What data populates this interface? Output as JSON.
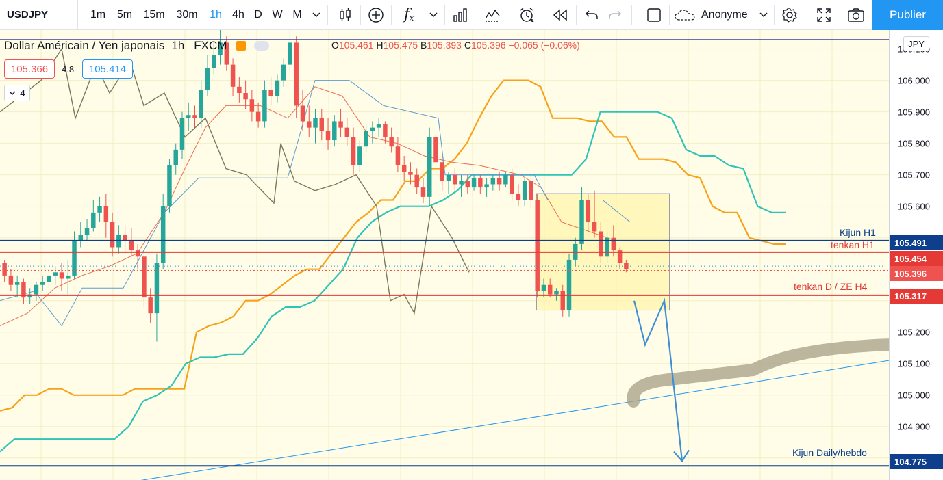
{
  "toolbar": {
    "symbol": "USDJPY",
    "intervals": [
      "1m",
      "5m",
      "15m",
      "30m",
      "1h",
      "4h",
      "D",
      "W",
      "M"
    ],
    "active_interval": "1h",
    "template_label": "Anonyme",
    "publish_label": "Publier",
    "fx_label": "f"
  },
  "legend": {
    "title": "Dollar Américain / Yen japonais",
    "interval": "1h",
    "source": "FXCM",
    "o_label": "O",
    "o": "105.461",
    "h_label": "H",
    "h": "105.475",
    "l_label": "B",
    "l": "105.393",
    "c_label": "C",
    "c": "105.396",
    "change": "−0.065 (−0.06%)",
    "bid": "105.366",
    "spread": "4.8",
    "ask": "105.414",
    "indicators_count": "4"
  },
  "price_axis": {
    "currency": "JPY",
    "ticks": [
      "106.100",
      "106.000",
      "105.900",
      "105.800",
      "105.700",
      "105.600",
      "105.300",
      "105.200",
      "105.100",
      "105.000",
      "104.900",
      "104.800"
    ]
  },
  "levels": [
    {
      "label": "Kijun H1",
      "price": "105.491",
      "color": "#0d3f8c",
      "tag_bg": "#0d3f8c"
    },
    {
      "label": "tenkan H1",
      "price": "105.454",
      "color": "#e53935",
      "tag_bg": "#e53935"
    },
    {
      "label": "",
      "price": "105.396",
      "color": "#ef5350",
      "tag_bg": "#ef5350"
    },
    {
      "label": "tenkan D / ZE H4",
      "price": "105.317",
      "color": "#e53935",
      "tag_bg": "#e53935"
    },
    {
      "label": "Kijun Daily/hebdo",
      "price": "104.775",
      "color": "#0d3f8c",
      "tag_bg": "#0d3f8c"
    }
  ],
  "colors": {
    "up": "#26a69a",
    "down": "#ef5350",
    "accent": "#2196f3",
    "chart_bg": "#fffde7"
  },
  "chart_data": {
    "type": "candlestick",
    "symbol": "USDJPY",
    "interval": "1h",
    "ylim": [
      104.73,
      106.16
    ],
    "candles": [
      [
        105.42,
        105.43,
        105.36,
        105.38
      ],
      [
        105.38,
        105.4,
        105.33,
        105.35
      ],
      [
        105.35,
        105.38,
        105.31,
        105.36
      ],
      [
        105.36,
        105.37,
        105.29,
        105.31
      ],
      [
        105.31,
        105.34,
        105.29,
        105.32
      ],
      [
        105.32,
        105.36,
        105.3,
        105.35
      ],
      [
        105.35,
        105.38,
        105.33,
        105.36
      ],
      [
        105.36,
        105.4,
        105.34,
        105.38
      ],
      [
        105.38,
        105.41,
        105.35,
        105.39
      ],
      [
        105.39,
        105.42,
        105.33,
        105.37
      ],
      [
        105.37,
        105.43,
        105.32,
        105.38
      ],
      [
        105.38,
        105.52,
        105.37,
        105.49
      ],
      [
        105.49,
        105.55,
        105.47,
        105.51
      ],
      [
        105.51,
        105.56,
        105.49,
        105.53
      ],
      [
        105.53,
        105.62,
        105.52,
        105.58
      ],
      [
        105.58,
        105.63,
        105.55,
        105.6
      ],
      [
        105.6,
        105.64,
        105.5,
        105.55
      ],
      [
        105.55,
        105.58,
        105.44,
        105.47
      ],
      [
        105.47,
        105.54,
        105.45,
        105.51
      ],
      [
        105.51,
        105.54,
        105.45,
        105.49
      ],
      [
        105.49,
        105.53,
        105.44,
        105.46
      ],
      [
        105.46,
        105.48,
        105.4,
        105.44
      ],
      [
        105.44,
        105.46,
        105.28,
        105.31
      ],
      [
        105.31,
        105.34,
        105.23,
        105.26
      ],
      [
        105.26,
        105.45,
        105.17,
        105.42
      ],
      [
        105.42,
        105.64,
        105.4,
        105.6
      ],
      [
        105.6,
        105.75,
        105.58,
        105.73
      ],
      [
        105.73,
        105.8,
        105.7,
        105.78
      ],
      [
        105.78,
        105.9,
        105.75,
        105.88
      ],
      [
        105.88,
        105.93,
        105.84,
        105.89
      ],
      [
        105.89,
        105.92,
        105.85,
        105.88
      ],
      [
        105.88,
        106.0,
        105.85,
        105.97
      ],
      [
        105.97,
        106.08,
        105.95,
        106.04
      ],
      [
        106.04,
        106.12,
        106.02,
        106.08
      ],
      [
        106.08,
        106.16,
        106.05,
        106.12
      ],
      [
        106.12,
        106.14,
        106.03,
        106.05
      ],
      [
        106.05,
        106.07,
        105.95,
        105.98
      ],
      [
        105.98,
        106.01,
        105.93,
        105.96
      ],
      [
        105.96,
        106.0,
        105.91,
        105.94
      ],
      [
        105.94,
        105.97,
        105.87,
        105.9
      ],
      [
        105.9,
        105.93,
        105.85,
        105.87
      ],
      [
        105.87,
        106.0,
        105.85,
        105.97
      ],
      [
        105.97,
        106.01,
        105.92,
        105.95
      ],
      [
        105.95,
        106.02,
        105.93,
        106.0
      ],
      [
        106.0,
        106.07,
        105.98,
        106.05
      ],
      [
        106.05,
        106.16,
        106.02,
        106.12
      ],
      [
        106.12,
        106.14,
        105.88,
        105.92
      ],
      [
        105.92,
        105.97,
        105.84,
        105.87
      ],
      [
        105.87,
        105.92,
        105.82,
        105.85
      ],
      [
        105.85,
        105.91,
        105.8,
        105.88
      ],
      [
        105.88,
        105.91,
        105.81,
        105.84
      ],
      [
        105.84,
        105.88,
        105.78,
        105.81
      ],
      [
        105.81,
        105.89,
        105.79,
        105.87
      ],
      [
        105.87,
        105.91,
        105.82,
        105.85
      ],
      [
        105.85,
        105.88,
        105.79,
        105.82
      ],
      [
        105.82,
        105.85,
        105.7,
        105.73
      ],
      [
        105.73,
        105.81,
        105.71,
        105.79
      ],
      [
        105.79,
        105.86,
        105.77,
        105.84
      ],
      [
        105.84,
        105.87,
        105.8,
        105.85
      ],
      [
        105.85,
        105.88,
        105.82,
        105.86
      ],
      [
        105.86,
        105.87,
        105.8,
        105.82
      ],
      [
        105.82,
        105.85,
        105.77,
        105.79
      ],
      [
        105.79,
        105.82,
        105.71,
        105.73
      ],
      [
        105.73,
        105.76,
        105.68,
        105.71
      ],
      [
        105.71,
        105.74,
        105.67,
        105.7
      ],
      [
        105.7,
        105.72,
        105.64,
        105.66
      ],
      [
        105.66,
        105.69,
        105.61,
        105.63
      ],
      [
        105.63,
        105.85,
        105.6,
        105.82
      ],
      [
        105.82,
        105.84,
        105.71,
        105.74
      ],
      [
        105.74,
        105.76,
        105.65,
        105.68
      ],
      [
        105.68,
        105.71,
        105.64,
        105.7
      ],
      [
        105.7,
        105.72,
        105.65,
        105.67
      ],
      [
        105.67,
        105.7,
        105.63,
        105.68
      ],
      [
        105.68,
        105.7,
        105.64,
        105.66
      ],
      [
        105.66,
        105.7,
        105.65,
        105.69
      ],
      [
        105.69,
        105.7,
        105.64,
        105.66
      ],
      [
        105.66,
        105.69,
        105.63,
        105.67
      ],
      [
        105.67,
        105.7,
        105.65,
        105.69
      ],
      [
        105.69,
        105.71,
        105.65,
        105.67
      ],
      [
        105.67,
        105.71,
        105.66,
        105.7
      ],
      [
        105.7,
        105.72,
        105.62,
        105.64
      ],
      [
        105.64,
        105.67,
        105.6,
        105.62
      ],
      [
        105.62,
        105.69,
        105.6,
        105.68
      ],
      [
        105.68,
        105.7,
        105.59,
        105.62
      ],
      [
        105.62,
        105.64,
        105.31,
        105.33
      ],
      [
        105.33,
        105.37,
        105.31,
        105.35
      ],
      [
        105.35,
        105.37,
        105.31,
        105.32
      ],
      [
        105.32,
        105.34,
        105.3,
        105.33
      ],
      [
        105.33,
        105.35,
        105.25,
        105.27
      ],
      [
        105.27,
        105.45,
        105.25,
        105.43
      ],
      [
        105.43,
        105.5,
        105.41,
        105.48
      ],
      [
        105.48,
        105.66,
        105.46,
        105.62
      ],
      [
        105.62,
        105.64,
        105.52,
        105.55
      ],
      [
        105.55,
        105.65,
        105.5,
        105.52
      ],
      [
        105.52,
        105.55,
        105.42,
        105.44
      ],
      [
        105.44,
        105.52,
        105.42,
        105.5
      ],
      [
        105.5,
        105.54,
        105.44,
        105.46
      ],
      [
        105.46,
        105.47,
        105.4,
        105.42
      ],
      [
        105.42,
        105.43,
        105.39,
        105.4
      ]
    ],
    "series": [
      {
        "name": "",
        "color": "#f7a21b",
        "values": [
          104.95,
          104.96,
          105.0,
          105.0,
          105.02,
          105.02,
          105.0,
          105.0,
          105.0,
          105.0,
          105.0,
          105.02,
          105.02,
          105.02,
          105.02,
          105.02,
          105.2,
          105.22,
          105.23,
          105.25,
          105.3,
          105.3,
          105.32,
          105.35,
          105.38,
          105.4,
          105.4,
          105.45,
          105.5,
          105.55,
          105.58,
          105.62,
          105.62,
          105.68,
          105.68,
          105.72,
          105.72,
          105.75,
          105.8,
          105.88,
          105.95,
          106.0,
          106.0,
          106.0,
          105.98,
          105.88,
          105.88,
          105.88,
          105.87,
          105.87,
          105.82,
          105.82,
          105.75,
          105.75,
          105.75,
          105.74,
          105.7,
          105.69,
          105.6,
          105.58,
          105.58,
          105.5,
          105.49,
          105.48,
          105.48
        ]
      },
      {
        "name": "",
        "color": "#2ec4b6",
        "values": [
          104.82,
          104.86,
          104.86,
          104.86,
          104.86,
          104.86,
          104.86,
          104.86,
          104.86,
          104.9,
          104.98,
          105.0,
          105.03,
          105.1,
          105.12,
          105.12,
          105.13,
          105.13,
          105.18,
          105.25,
          105.28,
          105.28,
          105.3,
          105.35,
          105.4,
          105.5,
          105.55,
          105.58,
          105.6,
          105.6,
          105.6,
          105.62,
          105.65,
          105.7,
          105.7,
          105.7,
          105.7,
          105.7,
          105.7,
          105.7,
          105.7,
          105.75,
          105.9,
          105.9,
          105.9,
          105.9,
          105.9,
          105.88,
          105.78,
          105.76,
          105.76,
          105.73,
          105.72,
          105.6,
          105.58,
          105.58
        ]
      }
    ]
  }
}
